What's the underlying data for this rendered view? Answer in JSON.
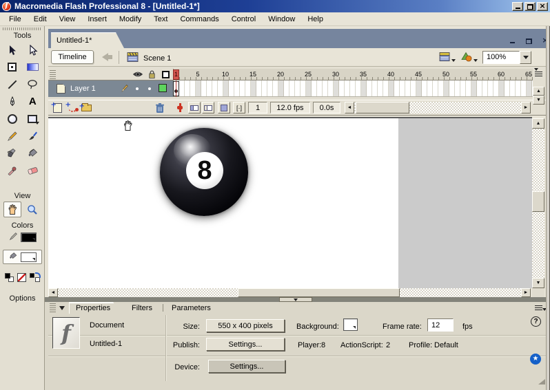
{
  "titlebar": {
    "title": "Macromedia Flash Professional 8 - [Untitled-1*]"
  },
  "menubar": {
    "items": [
      "File",
      "Edit",
      "View",
      "Insert",
      "Modify",
      "Text",
      "Commands",
      "Control",
      "Window",
      "Help"
    ]
  },
  "tools": {
    "title": "Tools",
    "view_label": "View",
    "colors_label": "Colors",
    "options_label": "Options",
    "tool_names": [
      "selection",
      "subselection",
      "free-transform",
      "gradient-transform",
      "line",
      "lasso",
      "pen",
      "text",
      "oval",
      "rectangle",
      "pencil",
      "brush",
      "ink-bottle",
      "paint-bucket",
      "eyedropper",
      "eraser",
      "hand",
      "zoom"
    ],
    "selected_tool": "hand",
    "stroke_color": "#000000",
    "fill_color": "#ffffff"
  },
  "icons": {
    "text_tool_glyph": "A",
    "flash_logo_glyph": "f",
    "help_glyph": "?",
    "accessibility_glyph": "★",
    "close_glyph": "×",
    "onion_markers_glyph": "[·]"
  },
  "document": {
    "tab_title": "Untitled-1*",
    "timeline_button": "Timeline",
    "scene_name": "Scene 1",
    "zoom_value": "100%",
    "timeline": {
      "layer_name": "Layer 1",
      "layer_outline_color": "#5dd45d",
      "ruler": [
        "1",
        "5",
        "10",
        "15",
        "20",
        "25",
        "30",
        "35",
        "40",
        "45",
        "50",
        "55",
        "60",
        "65"
      ],
      "current_frame": "1",
      "frame_rate": "12.0 fps",
      "elapsed_time": "0.0s"
    },
    "stage": {
      "object": "eight-ball",
      "ball_number": "8"
    }
  },
  "properties": {
    "tabs": [
      "Properties",
      "Filters",
      "Parameters"
    ],
    "doc_type": "Document",
    "doc_name": "Untitled-1",
    "size_label": "Size:",
    "size_value": "550 x 400 pixels",
    "background_label": "Background:",
    "frame_rate_label": "Frame rate:",
    "frame_rate_value": "12",
    "fps_label": "fps",
    "publish_label": "Publish:",
    "publish_button": "Settings...",
    "player_label": "Player:",
    "player_value": "8",
    "actionscript_label": "ActionScript:",
    "actionscript_value": "2",
    "profile_label": "Profile:",
    "profile_value": "Default",
    "device_label": "Device:",
    "device_button": "Settings..."
  },
  "colors": {
    "titlebar_gradient_start": "#0a246a",
    "titlebar_gradient_end": "#a6caf0",
    "panel_beige": "#e8e4d7",
    "tab_slate": "#76859e",
    "layer_selected": "#7c8894",
    "playhead_red": "#d2554e",
    "stage_white": "#ffffff",
    "pasteboard_gray": "#cbcbcb"
  }
}
